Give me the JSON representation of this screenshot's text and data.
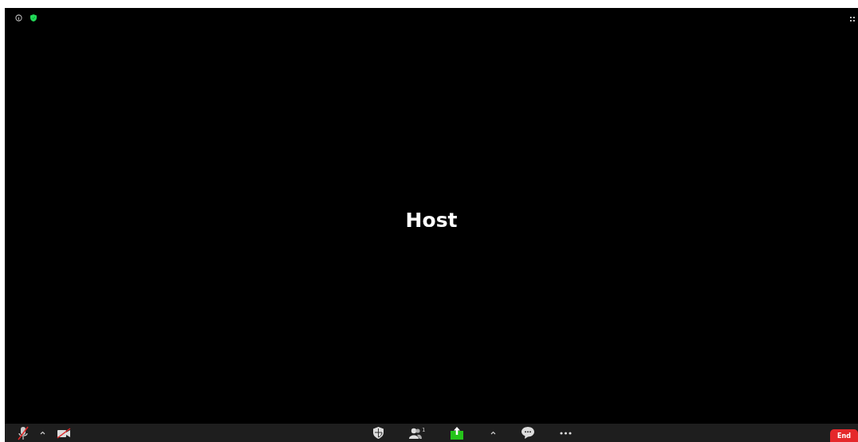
{
  "video": {
    "name": "Host"
  },
  "toolbar": {
    "audio_muted": true,
    "video_off": true,
    "participants_count": "1",
    "end_button": "End"
  }
}
